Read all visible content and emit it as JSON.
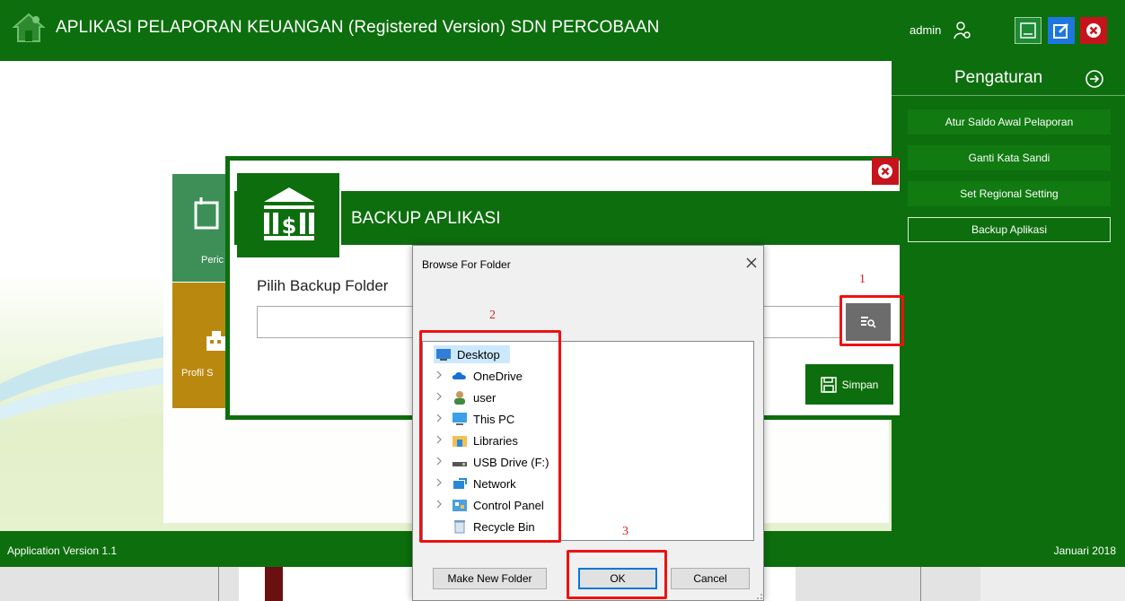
{
  "titlebar": {
    "title": "APLIKASI PELAPORAN KEUANGAN (Registered Version) SDN PERCOBAAN",
    "user": "admin",
    "icons": [
      "home-logo-icon",
      "user-settings-icon",
      "minimize-icon",
      "edit-icon",
      "close-icon"
    ]
  },
  "tiles": {
    "period_label": "Peric",
    "profile_label": "Profil S"
  },
  "right_panel": {
    "title": "Pengaturan",
    "items": [
      {
        "label": "Atur Saldo Awal Pelaporan"
      },
      {
        "label": "Ganti Kata Sandi"
      },
      {
        "label": "Set Regional Setting"
      },
      {
        "label": "Backup Aplikasi",
        "active": true
      }
    ]
  },
  "backup_dialog": {
    "title": "BACKUP APLIKASI",
    "folder_label": "Pilih Backup Folder",
    "folder_value": "",
    "save_label": "Simpan"
  },
  "folder_dialog": {
    "title": "Browse For Folder",
    "tree": [
      {
        "label": "Desktop",
        "icon": "desktop-icon",
        "selected": true
      },
      {
        "label": "OneDrive",
        "icon": "onedrive-icon"
      },
      {
        "label": "user",
        "icon": "user-icon"
      },
      {
        "label": "This PC",
        "icon": "this-pc-icon"
      },
      {
        "label": "Libraries",
        "icon": "libraries-icon"
      },
      {
        "label": "USB Drive (F:)",
        "icon": "usb-drive-icon"
      },
      {
        "label": "Network",
        "icon": "network-icon"
      },
      {
        "label": "Control Panel",
        "icon": "control-panel-icon"
      },
      {
        "label": "Recycle Bin",
        "icon": "recycle-bin-icon"
      }
    ],
    "new_folder_label": "Make New Folder",
    "ok_label": "OK",
    "cancel_label": "Cancel"
  },
  "annotations": {
    "step1": "1",
    "step2": "2",
    "step3": "3",
    "color": "#ee1111"
  },
  "footer": {
    "version": "Application Version 1.1",
    "date": "Januari 2018"
  },
  "colors": {
    "primary_green": "#0d6e0d",
    "close_red": "#c6141c",
    "edit_blue": "#1e77e0"
  }
}
